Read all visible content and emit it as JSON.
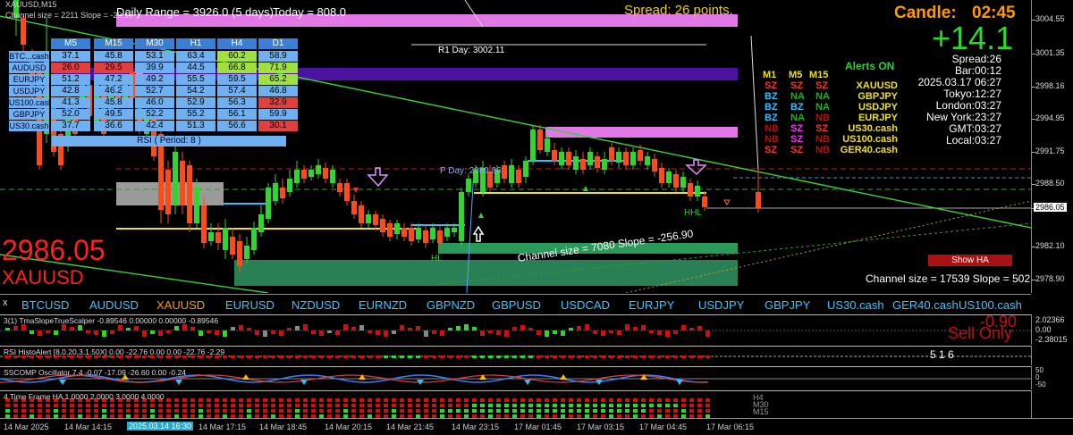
{
  "chart": {
    "symbol_tf": "XAUUSD,M15",
    "channel_info_top": "Channel size = 2211 Slope = -22.16",
    "daily_range": "Daily Range = 3926.0 (5 days)",
    "today": "Today = 808.0",
    "spread_top": "Spread: 26 points.",
    "r1_day": "R1 Day: 3002.11",
    "p_day": "P Day: 2989.86",
    "channel_mid": "Channel size = 7080 Slope = -256.90",
    "channel_right": "Channel size = 17539 Slope = 502",
    "big_price": "2986.05",
    "big_symbol": "XAUUSD",
    "rsi_label": "RSI ( Period: 8 )",
    "hl_labels": [
      "HL",
      "HL",
      "HHL"
    ],
    "price_marker": "2986.05",
    "ha_button": "Show HA"
  },
  "candle_panel": {
    "candle_label": "Candle:",
    "candle_time": "02:45",
    "big_change": "+14.1",
    "spread": "Spread:26",
    "bar": "Bar:00:12",
    "datetime": "2025.03.17 06:27",
    "tokyo": "Tokyo:12:27",
    "london": "London:03:27",
    "newyork": "New York:23:27",
    "gmt": "GMT:03:27",
    "local": "Local:03:27"
  },
  "alerts": {
    "title": "Alerts ON",
    "headers": [
      "M1",
      "M5",
      "M15"
    ],
    "rows": [
      {
        "m1": "SZ",
        "m5": "SZ",
        "m15": "SZ",
        "sym": "XAUUSD",
        "c1": "#ff3030",
        "c2": "#ff3030",
        "c3": "#ff3030"
      },
      {
        "m1": "BZ",
        "m5": "NA",
        "m15": "NA",
        "sym": "GBPJPY",
        "c1": "#30c0ff",
        "c2": "#20b020",
        "c3": "#20b020"
      },
      {
        "m1": "BZ",
        "m5": "BZ",
        "m15": "NA",
        "sym": "USDJPY",
        "c1": "#30c0ff",
        "c2": "#30c0ff",
        "c3": "#20b020"
      },
      {
        "m1": "BZ",
        "m5": "NA",
        "m15": "NB",
        "sym": "EURJPY",
        "c1": "#30c0ff",
        "c2": "#20b020",
        "c3": "#b01010"
      },
      {
        "m1": "NB",
        "m5": "SZ",
        "m15": "SZ",
        "sym": "US30.cash",
        "c1": "#b01010",
        "c2": "#ff30ff",
        "c3": "#ff3030"
      },
      {
        "m1": "NB",
        "m5": "SZ",
        "m15": "NB",
        "sym": "US100.cash",
        "c1": "#b01010",
        "c2": "#ff30ff",
        "c3": "#b01010"
      },
      {
        "m1": "SZ",
        "m5": "SZ",
        "m15": "NB",
        "sym": "GER40.cash",
        "c1": "#ff3030",
        "c2": "#ff3030",
        "c3": "#b01010"
      }
    ]
  },
  "rsi_table": {
    "columns": [
      "M5",
      "M15",
      "M30",
      "H1",
      "H4",
      "D1"
    ],
    "rows": [
      {
        "name": "BTC...cash",
        "values": [
          "37.1",
          "45.8",
          "53.1",
          "63.4",
          "60.2",
          "58.9"
        ],
        "colors": [
          "#6fb0f0",
          "#6fb0f0",
          "#6fb0f0",
          "#6fb0f0",
          "#a0e040",
          "#6fb0f0"
        ]
      },
      {
        "name": "AUDUSD",
        "values": [
          "26.0",
          "29.5",
          "39.9",
          "44.5",
          "66.8",
          "71.9"
        ],
        "colors": [
          "#e04040",
          "#e04040",
          "#6fb0f0",
          "#6fb0f0",
          "#a0e040",
          "#a0e040"
        ]
      },
      {
        "name": "EURJPY",
        "values": [
          "51.2",
          "47.2",
          "49.2",
          "55.5",
          "59.5",
          "65.2"
        ],
        "colors": [
          "#6fb0f0",
          "#6fb0f0",
          "#6fb0f0",
          "#6fb0f0",
          "#6fb0f0",
          "#a0e040"
        ]
      },
      {
        "name": "USDJPY",
        "values": [
          "42.8",
          "46.2",
          "52.7",
          "54.2",
          "57.4",
          "46.8"
        ],
        "colors": [
          "#6fb0f0",
          "#6fb0f0",
          "#6fb0f0",
          "#6fb0f0",
          "#6fb0f0",
          "#6fb0f0"
        ]
      },
      {
        "name": "US100.cash",
        "values": [
          "41.3",
          "45.8",
          "46.0",
          "52.9",
          "56.3",
          "32.9"
        ],
        "colors": [
          "#6fb0f0",
          "#6fb0f0",
          "#6fb0f0",
          "#6fb0f0",
          "#6fb0f0",
          "#e04040"
        ]
      },
      {
        "name": "GBPJPY",
        "values": [
          "52.0",
          "49.5",
          "52.2",
          "55.2",
          "56.1",
          "59.9"
        ],
        "colors": [
          "#6fb0f0",
          "#6fb0f0",
          "#6fb0f0",
          "#6fb0f0",
          "#6fb0f0",
          "#6fb0f0"
        ]
      },
      {
        "name": "US30.cash",
        "values": [
          "37.7",
          "36.6",
          "42.4",
          "51.3",
          "56.6",
          "30.1"
        ],
        "colors": [
          "#6fb0f0",
          "#6fb0f0",
          "#6fb0f0",
          "#6fb0f0",
          "#6fb0f0",
          "#e04040"
        ]
      }
    ]
  },
  "price_axis": [
    "3004.55",
    "3001.35",
    "2998.16",
    "2994.95",
    "2991.75",
    "2988.50",
    "2986.05",
    "2982.10",
    "2978.90"
  ],
  "symbol_bar": [
    "BTCUSD",
    "AUDUSD",
    "XAUUSD",
    "EURUSD",
    "NZDUSD",
    "EURNZD",
    "GBPNZD",
    "GBPUSD",
    "USDCAD",
    "EURJPY",
    "USDJPY",
    "GBPJPY",
    "US30.cash",
    "GER40.cash",
    "US100.cash"
  ],
  "symbol_active": "XAUUSD",
  "sub1": {
    "title": "3(1) TmaSlopeTrueScalper -0.89546 0.00000 0.00000 -0.89546",
    "value": "-0.90",
    "signal": "Sell Only",
    "scale": [
      "2.02366",
      "0.00",
      "-2.38015"
    ]
  },
  "sub2": {
    "title": "RSI HistoAlert [8,0.20,3,1.50X] 0.00 -22.76 0.00 0.00 -22.76 -2.29",
    "right_numbers": "5  1  6"
  },
  "sub3": {
    "title": "SSCOMP Oscillator 7.4 -0.07 -17.09 -26.60 0.00 -0.24",
    "scale": [
      "50",
      "0",
      "-50"
    ]
  },
  "sub4": {
    "title": "4 Time Frame HA 1.0000 2.0000 3.0000 4.0000",
    "tfs": [
      "H4",
      "M30",
      "M15"
    ]
  },
  "time_axis": [
    "14 Mar 2025",
    "14 Mar 14:15",
    "2025.03.14 16:30",
    "14 Mar 17:15",
    "14 Mar 18:45",
    "14 Mar 20:15",
    "14 Mar 21:45",
    "14 Mar 23:15",
    "17 Mar 01:45",
    "17 Mar 03:15",
    "17 Mar 04:45",
    "17 Mar 06:15"
  ]
}
